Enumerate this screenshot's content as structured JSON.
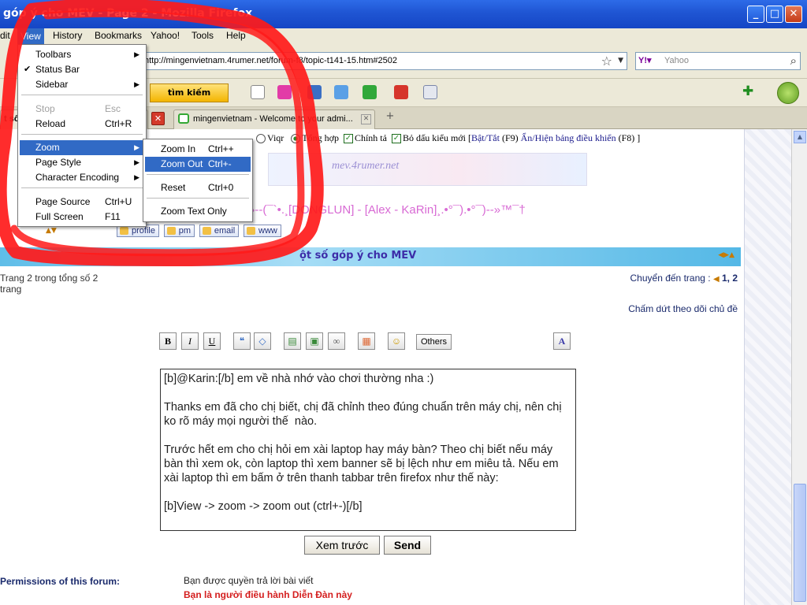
{
  "window": {
    "title": "góp ý cho MEV - Page 2 - Mozilla Firefox",
    "minimize": "_",
    "maximize": "□",
    "close": "✕"
  },
  "menubar": {
    "items": [
      "dit",
      "View",
      "History",
      "Bookmarks",
      "Yahoo!",
      "Tools",
      "Help"
    ]
  },
  "navbar": {
    "url": "http://mingenvietnam.4rumer.net/forum-f8/topic-t141-15.htm#2502",
    "search_placeholder": "Yahoo",
    "yahoo_badge": "Y!▾"
  },
  "toolbar": {
    "search_button": "tìm kiếm"
  },
  "tabs": {
    "first_label": "t số",
    "second_label": "mingenvietnam - Welcome to your admi...",
    "new_tab": "+"
  },
  "view_menu": {
    "items": [
      {
        "label": "Toolbars",
        "shortcut": "",
        "submenu": true
      },
      {
        "label": "Status Bar",
        "shortcut": "",
        "checked": true
      },
      {
        "label": "Sidebar",
        "shortcut": "",
        "submenu": true
      },
      {
        "label": "Stop",
        "shortcut": "Esc",
        "disabled": true
      },
      {
        "label": "Reload",
        "shortcut": "Ctrl+R"
      },
      {
        "label": "Zoom",
        "shortcut": "",
        "submenu": true,
        "highlighted": true
      },
      {
        "label": "Page Style",
        "shortcut": "",
        "submenu": true
      },
      {
        "label": "Character Encoding",
        "shortcut": "",
        "submenu": true
      },
      {
        "label": "Page Source",
        "shortcut": "Ctrl+U"
      },
      {
        "label": "Full Screen",
        "shortcut": "F11"
      }
    ]
  },
  "zoom_menu": {
    "items": [
      {
        "label": "Zoom In",
        "shortcut": "Ctrl++"
      },
      {
        "label": "Zoom Out",
        "shortcut": "Ctrl+-",
        "highlighted": true
      },
      {
        "label": "Reset",
        "shortcut": "Ctrl+0"
      },
      {
        "label": "Zoom Text Only",
        "shortcut": ""
      }
    ]
  },
  "editor_options": {
    "viqr": "Viqr",
    "tong_hop": "Tổng hợp",
    "chinh_ta": "Chính tả",
    "bo_dau": "Bỏ dấu kiểu mới [",
    "bat_tat": "Bật/Tắt",
    "bat_tat_key": "(F9)",
    "an_hien": "Ẩn/Hiện bảng điều khiển",
    "an_hien_key": "(F8) ]"
  },
  "post": {
    "banner_text": "mev.4rumer.net",
    "signature": "™»--(¯`•.¸[DONGLUN] - [Alex - KaRin]¸.•°¯).•°¯)--»™¯†",
    "profile_buttons": [
      "profile",
      "pm",
      "email",
      "www"
    ]
  },
  "topic": {
    "title": "ột số góp ý cho MEV",
    "page_info": "Trang 2 trong tổng số 2 trang",
    "jump_label": "Chuyển đến trang :",
    "jump_pages": "1, 2",
    "unwatch": "Chấm dứt theo dõi chủ đề"
  },
  "format_buttons": {
    "bold": "B",
    "italic": "I",
    "underline": "U",
    "others": "Others",
    "font": "A"
  },
  "message": {
    "text": "[b]@Karin:[/b] em về nhà nhớ vào chơi thường nha :)\n\nThanks em đã cho chị biết, chị đã chỉnh theo đúng chuẩn trên máy chị, nên chị ko rõ máy mọi người thế  nào.\n\nTrước hết em cho chị hỏi em xài laptop hay máy bàn? Theo chị biết nếu máy bàn thì xem ok, còn laptop thì xem banner sẽ bị lệch như em miêu tả. Nếu em xài laptop thì em bấm ở trên thanh tabbar trên firefox như thế này:\n\n[b]View -> zoom -> zoom out (ctrl+-)[/b]"
  },
  "actions": {
    "preview": "Xem trước",
    "send": "Send"
  },
  "permissions": {
    "label": "Permissions of this forum:",
    "line1": "Bạn được quyền trả lời bài viết",
    "line2": "Bạn là người điều hành Diễn Đàn này"
  },
  "colors": {
    "titlebar": "#1f55d3",
    "menu_highlight": "#316ac5",
    "annotation_red": "#ff1a1a",
    "topic_bar": "#5fbde8"
  }
}
